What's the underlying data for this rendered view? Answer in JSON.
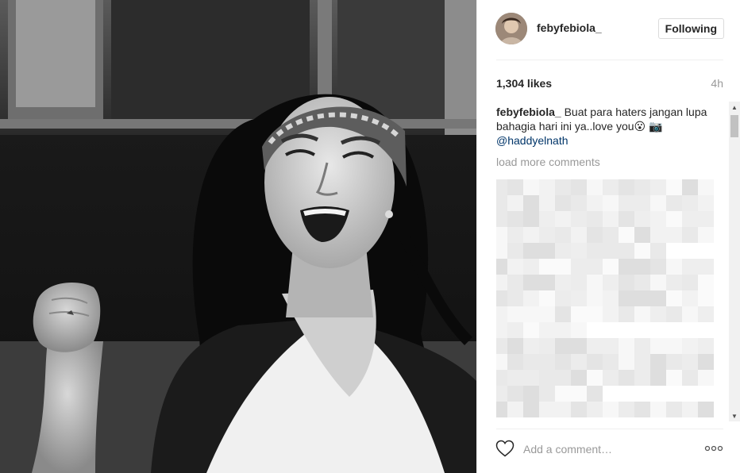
{
  "header": {
    "username": "febyfebiola_",
    "follow_label": "Following"
  },
  "stats": {
    "likes": "1,304 likes",
    "time": "4h"
  },
  "caption": {
    "username": "febyfebiola_",
    "text": " Buat para haters jangan lupa bahagia hari ini ya..love you😮 📷 ",
    "mention": "@haddyelnath"
  },
  "comments": {
    "load_more": "load more comments"
  },
  "footer": {
    "comment_placeholder": "Add a comment…"
  },
  "icons": {
    "like": "heart-icon",
    "more": "more-options-icon",
    "scroll_up": "scroll-up-arrow",
    "scroll_down": "scroll-down-arrow"
  },
  "colors": {
    "text": "#262626",
    "muted": "#999999",
    "mention": "#003569",
    "border": "#dbdbdb"
  }
}
